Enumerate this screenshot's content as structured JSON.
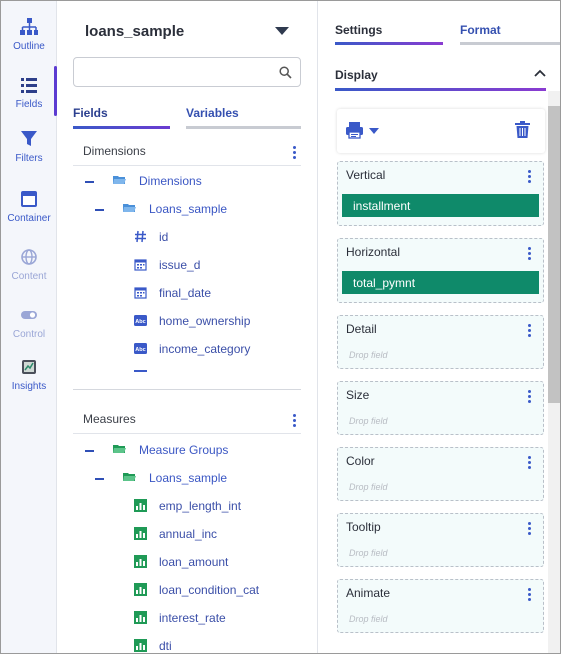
{
  "rail": {
    "items": [
      {
        "label": "Outline",
        "icon": "outline-icon"
      },
      {
        "label": "Fields",
        "icon": "fields-list-icon"
      },
      {
        "label": "Filters",
        "icon": "filter-icon"
      },
      {
        "label": "Container",
        "icon": "container-icon"
      },
      {
        "label": "Content",
        "icon": "globe-icon"
      },
      {
        "label": "Control",
        "icon": "toggle-icon"
      },
      {
        "label": "Insights",
        "icon": "insights-icon"
      }
    ]
  },
  "fields_panel": {
    "datasource": "loans_sample",
    "search": {
      "value": "",
      "placeholder": ""
    },
    "tabs": {
      "fields": "Fields",
      "variables": "Variables"
    },
    "dimensions": {
      "header": "Dimensions",
      "group": "Dimensions",
      "subgroup": "Loans_sample",
      "fields": [
        {
          "name": "id",
          "type": "number"
        },
        {
          "name": "issue_d",
          "type": "date"
        },
        {
          "name": "final_date",
          "type": "date"
        },
        {
          "name": "home_ownership",
          "type": "text"
        },
        {
          "name": "income_category",
          "type": "text"
        }
      ]
    },
    "measures": {
      "header": "Measures",
      "group": "Measure Groups",
      "subgroup": "Loans_sample",
      "fields": [
        {
          "name": "emp_length_int",
          "type": "measure"
        },
        {
          "name": "annual_inc",
          "type": "measure"
        },
        {
          "name": "loan_amount",
          "type": "measure"
        },
        {
          "name": "loan_condition_cat",
          "type": "measure"
        },
        {
          "name": "interest_rate",
          "type": "measure"
        },
        {
          "name": "dti",
          "type": "measure"
        }
      ]
    }
  },
  "settings_panel": {
    "tabs": {
      "settings": "Settings",
      "format": "Format"
    },
    "display": {
      "title": "Display"
    },
    "toolbar": {
      "print_icon": "print-icon",
      "delete_icon": "trash-icon"
    },
    "shelves": [
      {
        "label": "Vertical",
        "field": "installment"
      },
      {
        "label": "Horizontal",
        "field": "total_pymnt"
      },
      {
        "label": "Detail",
        "placeholder": "Drop field"
      },
      {
        "label": "Size",
        "placeholder": "Drop field"
      },
      {
        "label": "Color",
        "placeholder": "Drop field"
      },
      {
        "label": "Tooltip",
        "placeholder": "Drop field"
      },
      {
        "label": "Animate",
        "placeholder": "Drop field"
      }
    ]
  },
  "colors": {
    "accent_blue": "#3a59c8",
    "accent_purple": "#6b3bd1",
    "pill_green": "#0f8a6a",
    "shelf_bg": "#f3fbfb"
  }
}
